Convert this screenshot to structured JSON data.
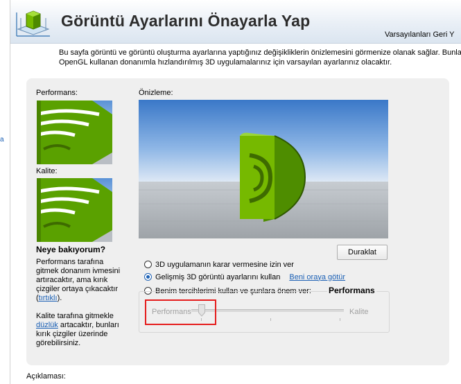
{
  "header": {
    "title": "Görüntü Ayarlarını Önayarla Yap",
    "restore_label": "Varsayılanları Geri Y",
    "description_line1": "Bu sayfa görüntü ve görüntü oluşturma ayarlarına yaptığınız değişikliklerin önizlemesini görmenize olanak sağlar. Bunlar Direc",
    "description_line2": "OpenGL kullanan donanımla hızlandırılmış 3D uygulamalarınız için varsayılan ayarlarınız olacaktır."
  },
  "left": {
    "performance_label": "Performans:",
    "quality_label": "Kalite:",
    "what_heading": "Neye bakıyorum?",
    "perf_text_1": "Performans tarafına gitmek donanım ivmesini artıracaktır, ama kırık çizgiler ortaya çıkacaktır (",
    "perf_link": "tırtıklı",
    "perf_text_2": ").",
    "qual_text_1": "Kalite tarafına gitmekle ",
    "qual_link": "düzlük",
    "qual_text_2": " artacaktır, bunları kırık çizgiler üzerinde görebilirsiniz."
  },
  "preview": {
    "label": "Önizleme:",
    "pause_button": "Duraklat"
  },
  "options": {
    "radio_app": "3D uygulamanın karar vermesine izin ver",
    "radio_advanced": "Gelişmiş 3D görüntü ayarlarını kullan",
    "take_me_there": "Beni oraya götür",
    "radio_custom": "Benim tercihlerimi kullan ve şunlara önem ver:",
    "selected": "radio_advanced"
  },
  "slider": {
    "group_title": "Performans",
    "left_label": "Performans",
    "right_label": "Kalite",
    "value_position": 0.07
  },
  "footer": {
    "description_label": "Açıklaması:"
  },
  "colors": {
    "logo_green": "#76b900",
    "link": "#1a5fb4",
    "highlight_red": "#e51c1c"
  }
}
